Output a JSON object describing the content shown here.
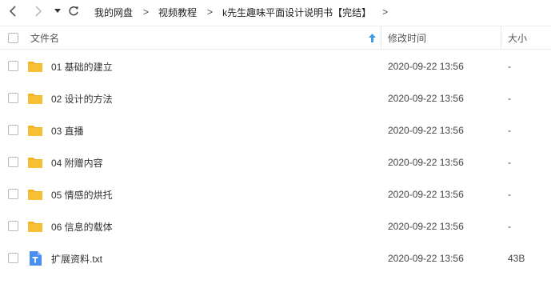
{
  "nav": {
    "breadcrumbs": [
      "我的网盘",
      "视频教程",
      "k先生趣味平面设计说明书【完结】"
    ],
    "sep": ">"
  },
  "header": {
    "name": "文件名",
    "modified": "修改时间",
    "size": "大小"
  },
  "files": [
    {
      "name": "01 基础的建立",
      "type": "folder",
      "modified": "2020-09-22 13:56",
      "size": "-"
    },
    {
      "name": "02 设计的方法",
      "type": "folder",
      "modified": "2020-09-22 13:56",
      "size": "-"
    },
    {
      "name": "03 直播",
      "type": "folder",
      "modified": "2020-09-22 13:56",
      "size": "-"
    },
    {
      "name": "04 附赠内容",
      "type": "folder",
      "modified": "2020-09-22 13:56",
      "size": "-"
    },
    {
      "name": "05 情感的烘托",
      "type": "folder",
      "modified": "2020-09-22 13:56",
      "size": "-"
    },
    {
      "name": "06 信息的载体",
      "type": "folder",
      "modified": "2020-09-22 13:56",
      "size": "-"
    },
    {
      "name": "扩展资料.txt",
      "type": "txt",
      "modified": "2020-09-22 13:56",
      "size": "43B"
    }
  ],
  "colors": {
    "folder": "#f7c034",
    "folder_tab": "#f0b323",
    "txt_icon": "#4b8ff0",
    "sort_arrow": "#3a9be8"
  }
}
